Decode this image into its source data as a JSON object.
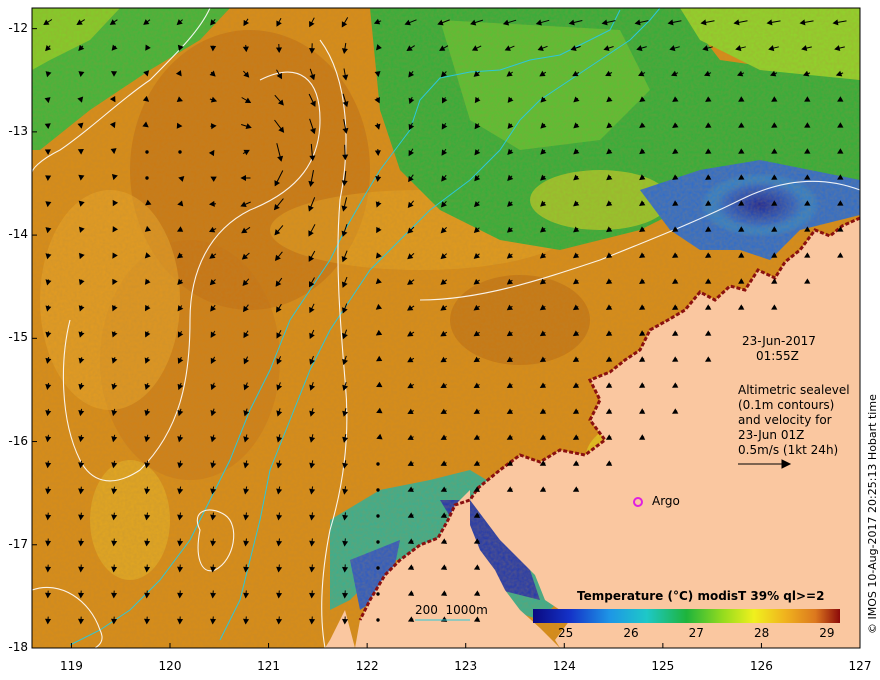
{
  "chart_data": {
    "type": "heatmap",
    "title": "Temperature (°C) modisT 39% ql>=2",
    "x_ticks": [
      "119",
      "120",
      "121",
      "122",
      "123",
      "124",
      "125",
      "126",
      "127"
    ],
    "y_ticks": [
      "-12",
      "-13",
      "-14",
      "-15",
      "-16",
      "-17",
      "-18"
    ],
    "xlim": [
      118.6,
      127
    ],
    "ylim": [
      -18,
      -11.8
    ],
    "colorbar": {
      "ticks": [
        "25",
        "26",
        "27",
        "28",
        "29"
      ],
      "range": [
        24.5,
        29.2
      ]
    },
    "date": "23-Jun-2017",
    "time": "01:55Z",
    "annotation_lines": [
      "Altimetric sealevel",
      "(0.1m contours)",
      "and velocity for",
      "23-Jun 01Z",
      "0.5m/s (1kt 24h)"
    ],
    "argo_label": "Argo",
    "argo_position": {
      "lon": 124.8,
      "lat": -16.55
    },
    "isobath_label": "200  1000m",
    "credit": "© IMOS 10-Aug-2017 20:25:13 Hobart time"
  },
  "colors": {
    "land": "#fac7a0",
    "warm": "#d88a14",
    "cool": "#1aa83a",
    "cold": "#1a2ea8",
    "isobath": "#2ec8d8",
    "argo": "#e020e0"
  }
}
